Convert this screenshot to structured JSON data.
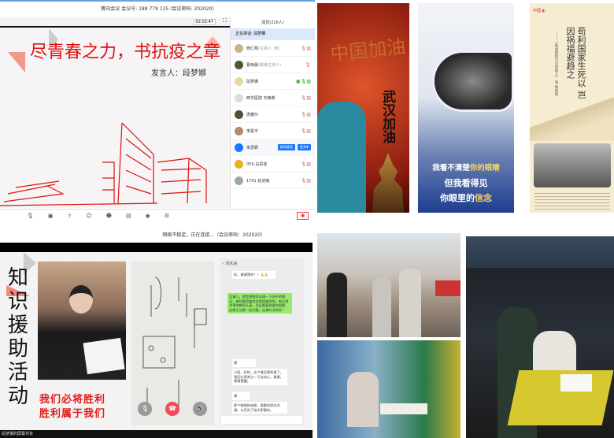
{
  "meeting": {
    "title": "腾讯会议 会议号: 188 779 135  (会议密码: 202020)",
    "timer": "02:02:47",
    "slide_title": "尽青春之力，书抗疫之章",
    "speaker": "发言人：段梦娜",
    "panel_title": "成员(216人)",
    "speaking": "正在讲话: 段梦娜",
    "participants": [
      {
        "name": "杨仁刚",
        "role": "(主持人, 我)"
      },
      {
        "name": "曹雨晨",
        "role": "(联席主持人)"
      },
      {
        "name": "段梦娜",
        "role": ""
      },
      {
        "name": "西华医院 刘雨菲",
        "role": ""
      },
      {
        "name": "唐雄玲",
        "role": ""
      },
      {
        "name": "李嘉平",
        "role": ""
      },
      {
        "name": "朱思颖",
        "role": "",
        "buttons": [
          "解除静音",
          "更多▼"
        ]
      },
      {
        "name": "055-白思佳",
        "role": ""
      },
      {
        "name": "1701 赵进雨",
        "role": ""
      }
    ]
  },
  "posters": {
    "p1_title": "中国加油",
    "p1_sub": "武汉加油",
    "p2_line1a": "我看不清楚",
    "p2_line1b": "你的眼睛",
    "p2_line2": "但我看得见",
    "p2_line3a": "你眼里的",
    "p2_line3b": "信念",
    "p3_quote": "苟利国家生死以 岂因祸福避趋之",
    "p3_source": "——《赴戍登程口占示家人》 清·林则徐"
  },
  "remote": {
    "status": "网络不稳定，正在连接...（会议密码：202020）",
    "vertical_title": "知识援助活动",
    "slogan1": "我们必将胜利",
    "slogan2": "胜利属于我们",
    "footer": "段梦娜的屏幕共享",
    "chat_contact": "刘大夫",
    "chat_msgs": [
      "好。谢谢我杂！！🙏🙏",
      "没事儿，就是想跟您沟通一下孩子的情况，做些题思路其实是很能明的。每次我讲课他都很认真。而且跟着我看的图题，这都主动提一些问题，这真的非常好！",
      "嗯",
      "小段，好的，这个情况我知道了，我回头再关注一下这块儿，谢谢，谢谢提醒。",
      "嗯",
      "那个物理的成绩，我跟刘思佳沟通，以后完了给大家看你。"
    ]
  },
  "colors": {
    "accent": "#1677ff",
    "slide_red": "#e01010"
  }
}
